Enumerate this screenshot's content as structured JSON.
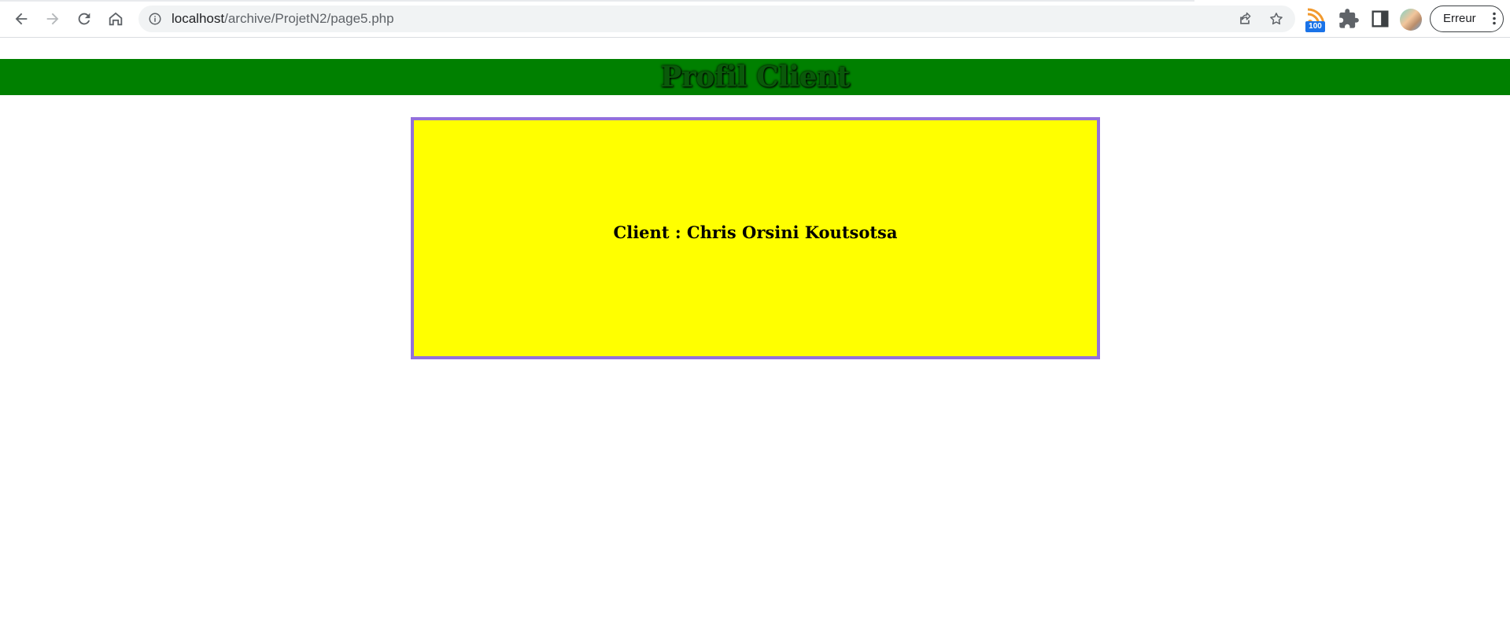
{
  "browser": {
    "url_host": "localhost",
    "url_path": "/archive/ProjetN2/page5.php",
    "extension_badge": "100",
    "profile_label": "Erreur"
  },
  "page": {
    "title": "Profil Client",
    "client_text": "Client : Chris Orsini Koutsotsa"
  },
  "icons": {
    "back": "back-arrow-icon",
    "forward": "forward-arrow-icon",
    "reload": "reload-icon",
    "home": "home-icon",
    "info": "info-icon",
    "share": "share-icon",
    "bookmark": "star-icon",
    "rss": "rss-icon",
    "extensions": "puzzle-icon",
    "side_panel": "side-panel-icon",
    "menu": "kebab-menu-icon"
  },
  "colors": {
    "banner_bg": "#008000",
    "banner_text": "#0a5a0a",
    "box_bg": "#ffff00",
    "box_border": "#9370db"
  }
}
